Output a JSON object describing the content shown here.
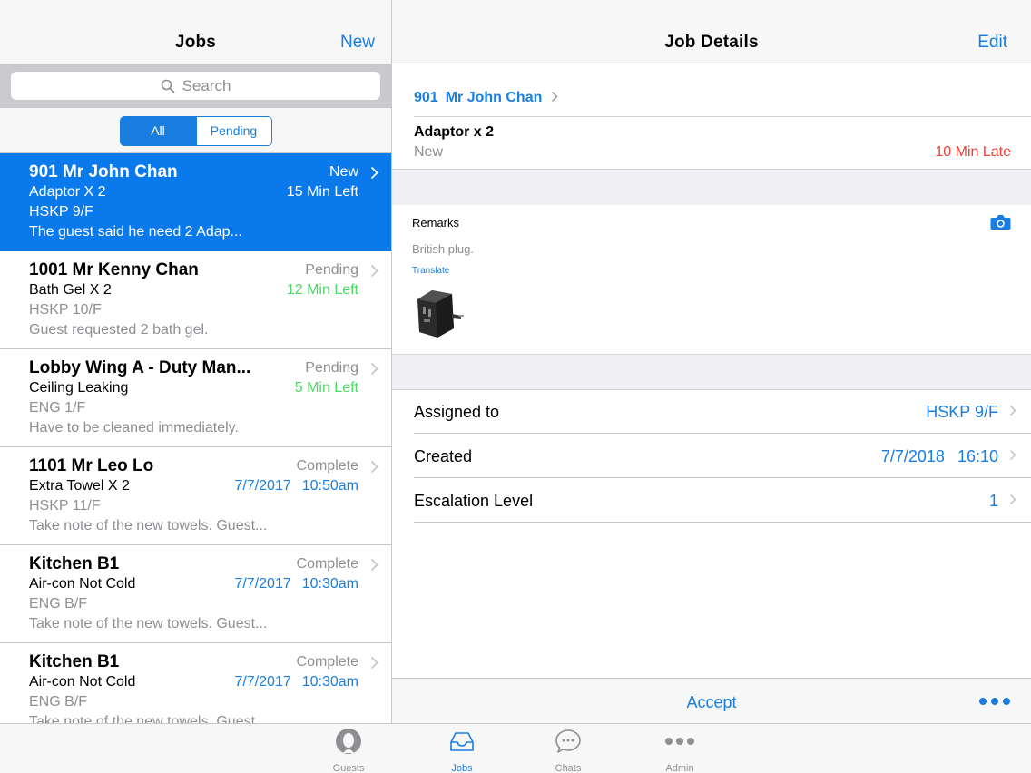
{
  "jobs_list": {
    "title": "Jobs",
    "new_label": "New",
    "search_placeholder": "Search",
    "filters": [
      "All",
      "Pending"
    ],
    "active_filter": "All",
    "items": [
      {
        "title": "901 Mr John Chan",
        "item": "Adaptor X 2",
        "dept": "HSKP 9/F",
        "note": "The guest said he need 2 Adap...",
        "status": "New",
        "time": "15 Min Left",
        "selected": true
      },
      {
        "title": "1001 Mr Kenny Chan",
        "item": "Bath Gel X 2",
        "dept": "HSKP 10/F",
        "note": "Guest requested 2 bath gel.",
        "status": "Pending",
        "time": "12 Min Left"
      },
      {
        "title": "Lobby Wing A - Duty Man...",
        "item": "Ceiling Leaking",
        "dept": "ENG 1/F",
        "note": "Have to be cleaned immediately.",
        "status": "Pending",
        "time": "5 Min Left"
      },
      {
        "title": "1101 Mr Leo Lo",
        "item": "Extra Towel X 2",
        "dept": "HSKP 11/F",
        "note": "Take note of the new towels. Guest...",
        "status": "Complete",
        "date": "7/7/2017",
        "clock": "10:50am"
      },
      {
        "title": "Kitchen B1",
        "item": "Air-con Not Cold",
        "dept": "ENG B/F",
        "note": "Take note of the new towels. Guest...",
        "status": "Complete",
        "date": "7/7/2017",
        "clock": "10:30am"
      },
      {
        "title": "Kitchen B1",
        "item": "Air-con Not Cold",
        "dept": "ENG B/F",
        "note": "Take note of the new towels. Guest...",
        "status": "Complete",
        "date": "7/7/2017",
        "clock": "10:30am"
      }
    ]
  },
  "detail": {
    "title": "Job Details",
    "edit_label": "Edit",
    "room": "901",
    "guest": "Mr John Chan",
    "item": "Adaptor x 2",
    "status": "New",
    "late": "10 Min Late",
    "remarks_label": "Remarks",
    "remarks_text": "British plug.",
    "translate_label": "Translate",
    "assigned_label": "Assigned to",
    "assigned_value": "HSKP 9/F",
    "created_label": "Created",
    "created_date": "7/7/2018",
    "created_time": "16:10",
    "escalation_label": "Escalation Level",
    "escalation_value": "1",
    "accept_label": "Accept"
  },
  "tabs": [
    {
      "label": "Guests",
      "icon": "guest-avatar-icon"
    },
    {
      "label": "Jobs",
      "icon": "inbox-tray-icon"
    },
    {
      "label": "Chats",
      "icon": "chat-bubble-icon"
    },
    {
      "label": "Admin",
      "icon": "more-dots-icon"
    }
  ],
  "active_tab": "Jobs",
  "colors": {
    "accent": "#1a7ee0",
    "selected_row": "#0a79ec",
    "late_red": "#e5433a",
    "time_green": "#4cd964",
    "group_gray": "#efeff4"
  }
}
